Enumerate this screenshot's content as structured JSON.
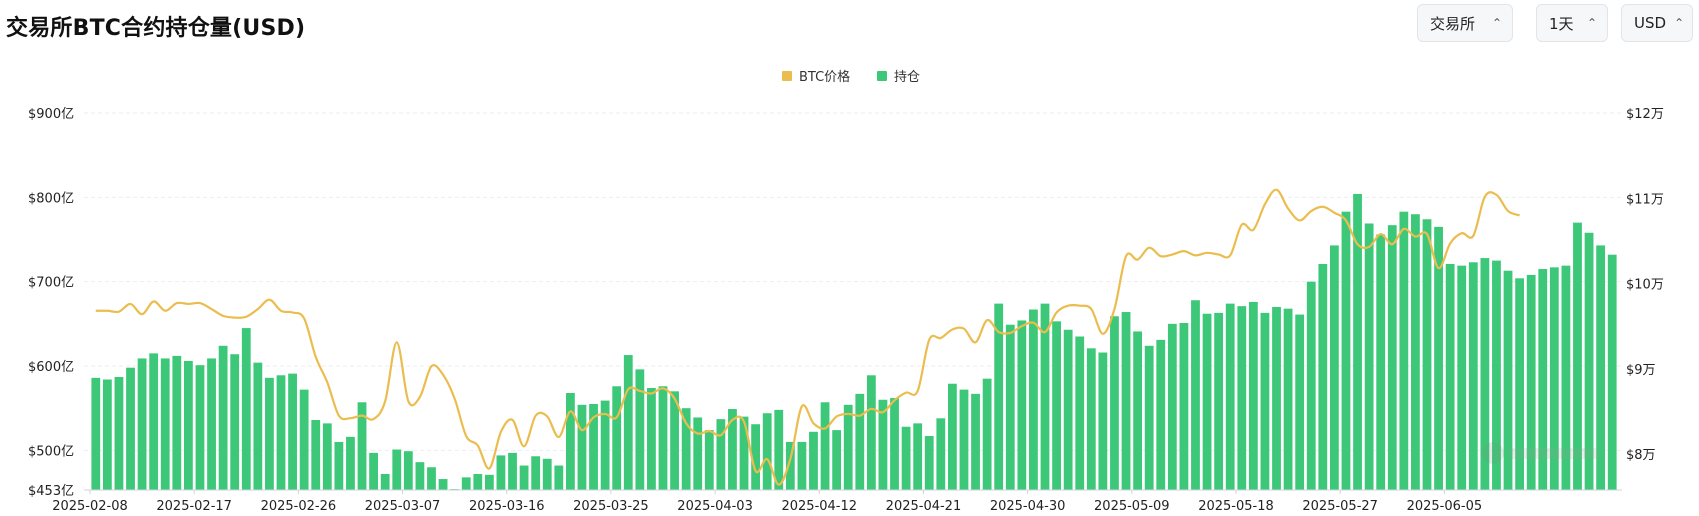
{
  "header": {
    "title": "交易所BTC合约持仓量(USD)",
    "controls": [
      {
        "label": "交易所",
        "icon": "chevron-up-down-icon"
      },
      {
        "label": "1天",
        "icon": "chevron-up-down-icon"
      },
      {
        "label": "USD",
        "icon": "chevron-up-down-icon"
      }
    ]
  },
  "chart_data": {
    "type": "bar",
    "colors": {
      "open_interest": "#3cc878",
      "btc_price": "#ebbd4f",
      "grid": "#eceef1",
      "axis_text": "#222222"
    },
    "legend": [
      {
        "name": "BTC价格",
        "color": "#ebbd4f"
      },
      {
        "name": "持仓",
        "color": "#3cc878"
      }
    ],
    "legend_position": "top-center",
    "x_start": "2025-02-08",
    "x_tick_labels": [
      "2025-02-08",
      "2025-02-17",
      "2025-02-26",
      "2025-03-07",
      "2025-03-16",
      "2025-03-25",
      "2025-04-03",
      "2025-04-12",
      "2025-04-21",
      "2025-04-30",
      "2025-05-09",
      "2025-05-18",
      "2025-05-27",
      "2025-06-05"
    ],
    "y_left": {
      "min": 453,
      "max": 900,
      "ticks": [
        453,
        500,
        600,
        700,
        800,
        900
      ],
      "tick_labels": [
        "$453亿",
        "$500亿",
        "$600亿",
        "$700亿",
        "$800亿",
        "$900亿"
      ]
    },
    "y_right": {
      "min": 78000,
      "max": 120000,
      "ticks": [
        80000,
        90000,
        100000,
        110000,
        120000
      ],
      "tick_labels": [
        "$8万",
        "$9万",
        "$10万",
        "$11万",
        "$12万"
      ]
    },
    "grid": true,
    "series": [
      {
        "name": "持仓",
        "axis": "left",
        "type": "bar",
        "values": [
          586,
          584,
          587,
          598,
          609,
          615,
          609,
          612,
          606,
          601,
          609,
          624,
          614,
          645,
          604,
          586,
          589,
          591,
          572,
          536,
          532,
          510,
          516,
          557,
          497,
          472,
          501,
          499,
          486,
          480,
          466,
          454,
          468,
          472,
          471,
          494,
          497,
          482,
          493,
          490,
          482,
          568,
          554,
          555,
          559,
          576,
          613,
          596,
          574,
          576,
          570,
          550,
          539,
          524,
          537,
          549,
          540,
          531,
          544,
          548,
          510,
          510,
          522,
          557,
          524,
          554,
          567,
          589,
          560,
          562,
          528,
          532,
          517,
          538,
          579,
          572,
          567,
          585,
          674,
          649,
          654,
          667,
          674,
          653,
          643,
          635,
          621,
          616,
          659,
          664,
          641,
          624,
          631,
          650,
          651,
          678,
          662,
          663,
          674,
          671,
          676,
          663,
          670,
          668,
          661,
          700,
          721,
          743,
          783,
          804,
          769,
          756,
          767,
          783,
          780,
          774,
          765,
          721,
          719,
          723,
          728,
          725,
          713,
          704,
          708,
          715,
          717,
          719,
          770,
          758,
          743,
          732
        ]
      },
      {
        "name": "BTC价格",
        "axis": "right",
        "type": "line",
        "values": [
          96800,
          96800,
          96700,
          97600,
          96400,
          97900,
          96800,
          97700,
          97600,
          97700,
          97000,
          96200,
          96000,
          96100,
          97000,
          98100,
          96800,
          96600,
          95900,
          91400,
          88400,
          84500,
          84200,
          84500,
          84100,
          86200,
          93100,
          86200,
          86700,
          90300,
          89300,
          86500,
          82100,
          81000,
          78300,
          82600,
          84000,
          80900,
          84500,
          84400,
          82000,
          85000,
          82800,
          84300,
          84700,
          84300,
          87600,
          87400,
          87100,
          87700,
          86500,
          83600,
          82400,
          82700,
          82200,
          84000,
          83800,
          78000,
          79400,
          76400,
          79400,
          85600,
          83600,
          83000,
          84400,
          84700,
          84500,
          85300,
          84900,
          86300,
          87200,
          87400,
          93400,
          93600,
          94600,
          94700,
          93100,
          95700,
          94300,
          94200,
          95000,
          95400,
          94300,
          96600,
          97400,
          97400,
          97000,
          94100,
          97000,
          103200,
          102800,
          104200,
          103200,
          103400,
          103800,
          103300,
          103600,
          103400,
          103300,
          106900,
          106300,
          109300,
          111000,
          108800,
          107400,
          108500,
          109000,
          108300,
          107400,
          104600,
          104300,
          105800,
          104600,
          106400,
          105500,
          105800,
          101800,
          104700,
          105900,
          105600,
          110200,
          110400,
          108500,
          108000
        ]
      }
    ]
  }
}
